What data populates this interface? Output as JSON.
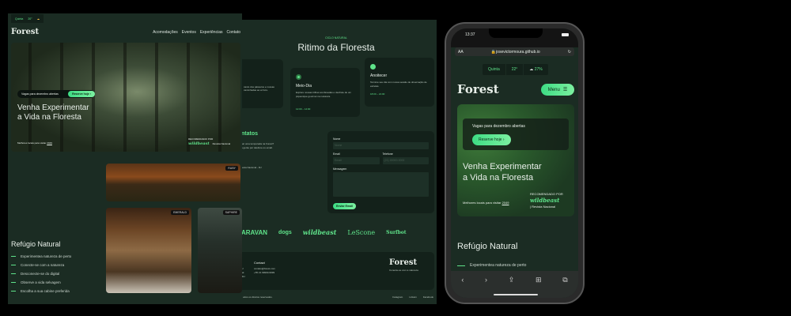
{
  "desktop": {
    "weather": {
      "day": "Quinta",
      "temp": "20°",
      "icon": "sun-cloud-icon"
    },
    "logo": "Forest",
    "nav": [
      "Acomodações",
      "Eventos",
      "Experiências",
      "Contato"
    ],
    "hero": {
      "pill_text": "Vagas para dezembro abertas",
      "cta": "Reserve hoje ›",
      "title_line1": "Venha Experimentar",
      "title_line2": "a Vida na Floresta",
      "subtitle": "Melhores locais para visitar",
      "year": "2049",
      "recommended": "RECOMENDADO POR",
      "brand": "wildbeast",
      "magazine": "Revista Nacional"
    },
    "refugio": {
      "title": "Refúgio Natural",
      "items": [
        "Experimentea natureza de perto",
        "Conecte-se com a natureza",
        "Desconecte-se do digital",
        "Observe a vida selvagem",
        "Escolha a sua cabine preferida"
      ]
    },
    "photo_tags": [
      "RUBY",
      "EMERALD",
      "SAPHIRE"
    ]
  },
  "middle": {
    "eyebrow": "CICLO NATURAL",
    "title": "Ritimo da Floresta",
    "cards": [
      {
        "title": "",
        "text": "canto dos pássaros e nossas caminhadas ao ar livre.",
        "time": ""
      },
      {
        "title": "Meio-Dia",
        "text": "Explore nossas trilhas sombreadas e desfrute de um piquenique gourmet na natureza.",
        "time": "12:00 – 14:00"
      },
      {
        "title": "Anoitecer",
        "text": "Termine seu dia com nossa sessão de observação de estrelas.",
        "time": "18:00 – 21:00"
      }
    ],
    "contact": {
      "title": "ntatos",
      "text1": "sar uma temporada na Forest?",
      "text2": "a gente por telefone ou email.",
      "address": "resta Nacional - RJ"
    },
    "form": {
      "name_label": "Nome",
      "name_placeholder": "Nome",
      "email_label": "Email",
      "email_placeholder": "Email",
      "phone_label": "Telefone",
      "phone_placeholder": "(21) 00000-0000",
      "message_label": "Mensagem",
      "submit": "Enviar Email"
    },
    "partners": [
      "ARAVAN",
      "dogs",
      "wildbeast",
      "LeScone",
      "Surfbot"
    ],
    "footer": {
      "contact_title": "Contact",
      "email": "contato@forest.com",
      "phone": "+55 21 99990-9999",
      "logo": "Forest",
      "tagline": "Conecte-se com a natureza",
      "left_frag": [
        "J",
        "al",
        "RJ"
      ],
      "copyright": "odos os direitos reservados.",
      "links": [
        "Instagram",
        "Linkein",
        "Facebook"
      ]
    }
  },
  "phone": {
    "time": "13:37",
    "url": "josevictormoura.github.io",
    "aa": "AA",
    "weather": {
      "day": "Quinta",
      "temp": "22°",
      "humidity": "27%"
    },
    "logo": "Forest",
    "menu": "Menu",
    "hero": {
      "pill_text": "Vagas para dezembro abertas",
      "cta": "Reserve hoje ›",
      "title_line1": "Venha Experimentar",
      "title_line2": "a Vida na Floresta",
      "subtitle": "Melhores locais para visitar",
      "year": "2049",
      "recommended": "RECOMENDADO POR",
      "brand": "wildbeast",
      "magazine": "| Revista Nacional"
    },
    "refugio_title": "Refúgio Natural",
    "first_item": "Experimentea natureza de perto"
  }
}
